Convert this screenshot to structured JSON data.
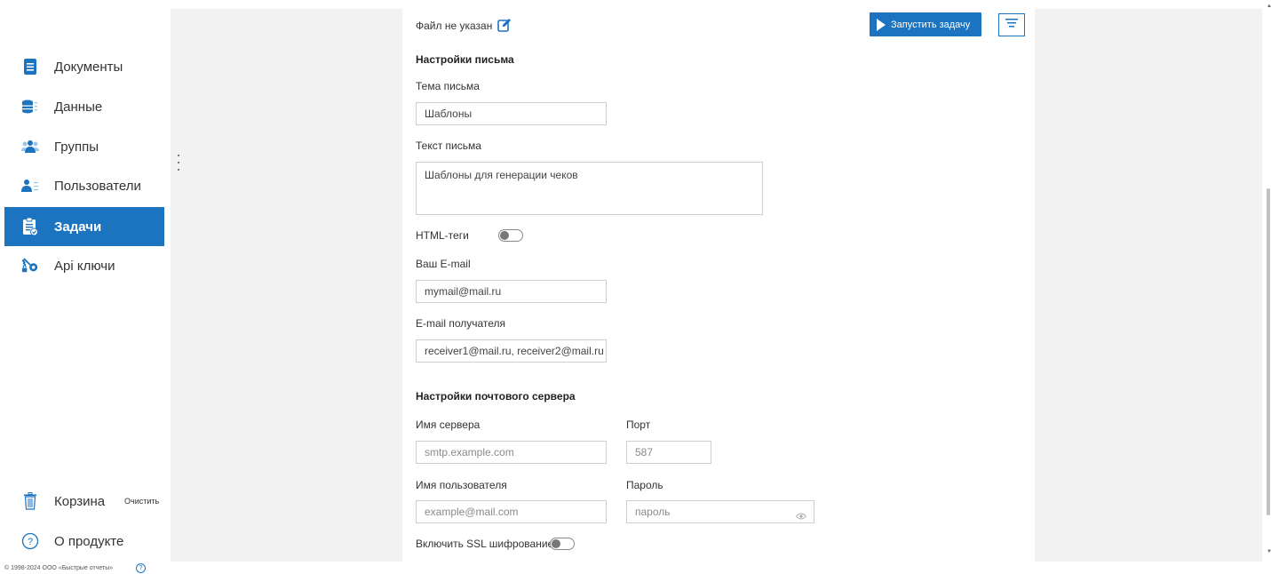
{
  "sidebar": {
    "items": [
      {
        "label": "Документы",
        "icon": "document-icon"
      },
      {
        "label": "Данные",
        "icon": "database-icon"
      },
      {
        "label": "Группы",
        "icon": "group-icon"
      },
      {
        "label": "Пользователи",
        "icon": "users-icon"
      },
      {
        "label": "Задачи",
        "icon": "tasks-icon",
        "active": true
      },
      {
        "label": "Api ключи",
        "icon": "key-icon"
      }
    ],
    "trash_label": "Корзина",
    "clear_label": "Очистить",
    "about_label": "О продукте"
  },
  "header": {
    "file_status": "Файл не указан",
    "run_button": "Запустить задачу"
  },
  "email_settings": {
    "section_title": "Настройки письма",
    "subject_label": "Тема письма",
    "subject_value": "Шаблоны",
    "body_label": "Текст письма",
    "body_value": "Шаблоны для генерации чеков",
    "html_tags_label": "HTML-теги",
    "your_email_label": "Ваш E-mail",
    "your_email_value": "mymail@mail.ru",
    "recipient_label": "E-mail получателя",
    "recipient_value": "receiver1@mail.ru, receiver2@mail.ru"
  },
  "server_settings": {
    "section_title": "Настройки почтового сервера",
    "server_label": "Имя сервера",
    "server_placeholder": "smtp.example.com",
    "port_label": "Порт",
    "port_placeholder": "587",
    "username_label": "Имя пользователя",
    "username_placeholder": "example@mail.com",
    "password_label": "Пароль",
    "password_placeholder": "пароль",
    "ssl_label": "Включить SSL шифрование"
  },
  "footer": {
    "copyright": "© 1998-2024 ООО «Быстрые отчеты»"
  },
  "colors": {
    "accent": "#1c74c0",
    "panel_gray": "#f2f2f2"
  }
}
